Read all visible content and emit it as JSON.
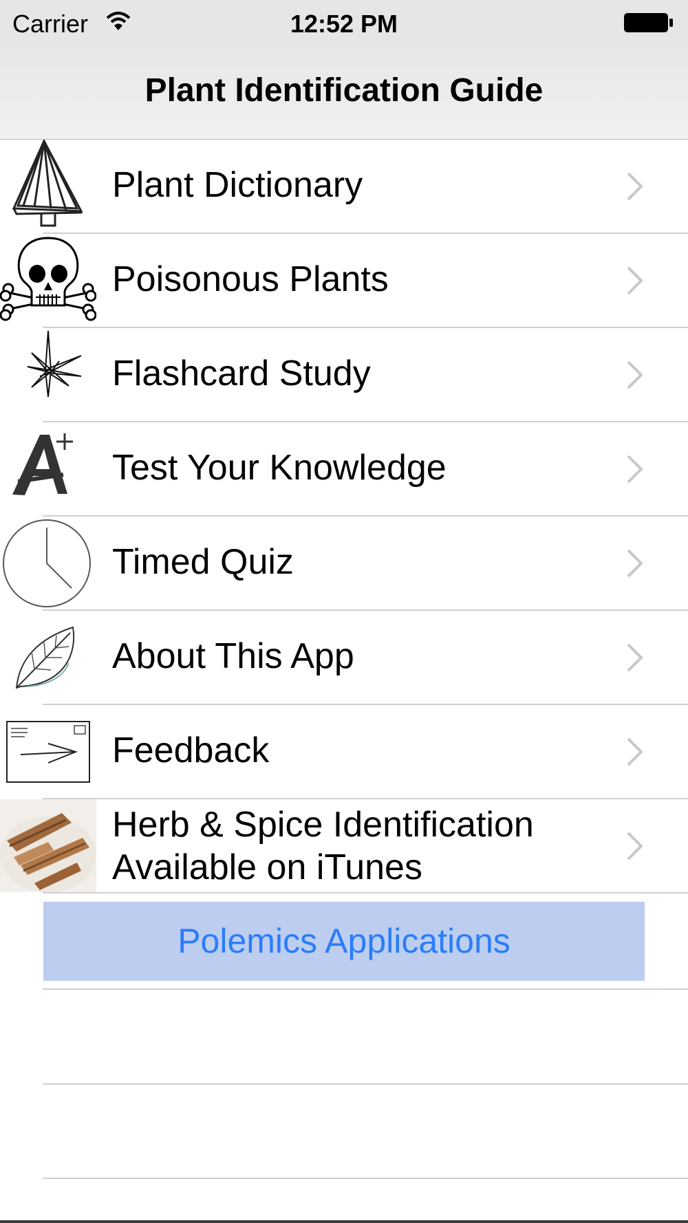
{
  "status_bar": {
    "carrier": "Carrier",
    "time": "12:52 PM",
    "wifi_icon": "wifi-icon",
    "battery_icon": "battery-icon"
  },
  "nav": {
    "title": "Plant Identification Guide"
  },
  "menu": {
    "items": [
      {
        "label": "Plant Dictionary",
        "icon": "tree-icon"
      },
      {
        "label": "Poisonous Plants",
        "icon": "skull-crossbones-icon"
      },
      {
        "label": "Flashcard Study",
        "icon": "star-burst-icon"
      },
      {
        "label": "Test Your Knowledge",
        "icon": "a-plus-icon"
      },
      {
        "label": "Timed Quiz",
        "icon": "clock-icon"
      },
      {
        "label": "About This App",
        "icon": "leaf-icon"
      },
      {
        "label": "Feedback",
        "icon": "envelope-icon"
      },
      {
        "label_line1": "Herb & Spice Identification",
        "label_line2": "Available on iTunes",
        "icon": "cinnamon-photo-icon"
      }
    ],
    "chevron_icon": "chevron-right-icon"
  },
  "link_button": {
    "label": "Polemics Applications"
  },
  "colors": {
    "accent": "#2a7dfb",
    "link_button_bg": "#bccdf0",
    "separator": "#d0d0d0",
    "chevron": "#c7c7cc"
  }
}
